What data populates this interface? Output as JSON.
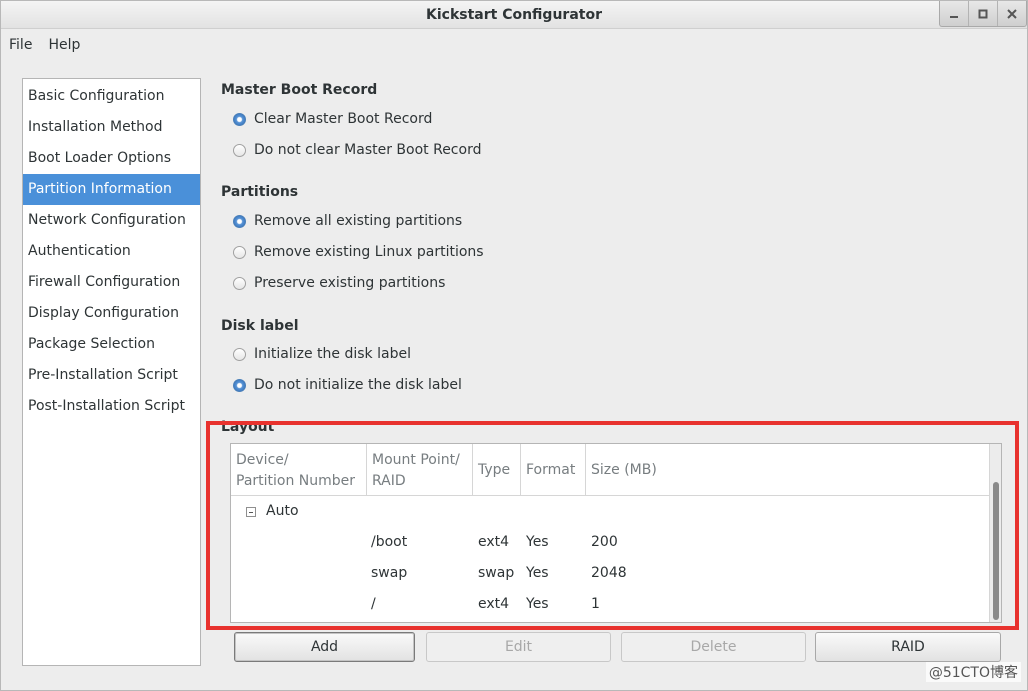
{
  "window": {
    "title": "Kickstart Configurator"
  },
  "menu": {
    "items": [
      "File",
      "Help"
    ]
  },
  "sidebar": {
    "items": [
      {
        "label": "Basic Configuration",
        "selected": false
      },
      {
        "label": "Installation Method",
        "selected": false
      },
      {
        "label": "Boot Loader Options",
        "selected": false
      },
      {
        "label": "Partition Information",
        "selected": true
      },
      {
        "label": "Network Configuration",
        "selected": false
      },
      {
        "label": "Authentication",
        "selected": false
      },
      {
        "label": "Firewall Configuration",
        "selected": false
      },
      {
        "label": "Display Configuration",
        "selected": false
      },
      {
        "label": "Package Selection",
        "selected": false
      },
      {
        "label": "Pre-Installation Script",
        "selected": false
      },
      {
        "label": "Post-Installation Script",
        "selected": false
      }
    ]
  },
  "mbr": {
    "title": "Master Boot Record",
    "options": [
      {
        "label": "Clear Master Boot Record",
        "checked": true
      },
      {
        "label": "Do not clear Master Boot Record",
        "checked": false
      }
    ]
  },
  "partitions": {
    "title": "Partitions",
    "options": [
      {
        "label": "Remove all existing partitions",
        "checked": true
      },
      {
        "label": "Remove existing Linux partitions",
        "checked": false
      },
      {
        "label": "Preserve existing partitions",
        "checked": false
      }
    ]
  },
  "disklabel": {
    "title": "Disk label",
    "options": [
      {
        "label": "Initialize the disk label",
        "checked": false
      },
      {
        "label": "Do not initialize the disk label",
        "checked": true
      }
    ]
  },
  "layout": {
    "title": "Layout",
    "columns": [
      {
        "line1": "Device/",
        "line2": "Partition Number"
      },
      {
        "line1": "Mount Point/",
        "line2": "RAID"
      },
      {
        "line1": "Type",
        "line2": ""
      },
      {
        "line1": "Format",
        "line2": ""
      },
      {
        "line1": "Size (MB)",
        "line2": ""
      }
    ],
    "group": "Auto",
    "rows": [
      {
        "mount": "/boot",
        "type": "ext4",
        "format": "Yes",
        "size": "200"
      },
      {
        "mount": "swap",
        "type": "swap",
        "format": "Yes",
        "size": "2048"
      },
      {
        "mount": "/",
        "type": "ext4",
        "format": "Yes",
        "size": "1"
      }
    ]
  },
  "buttons": {
    "add": "Add",
    "edit": "Edit",
    "delete": "Delete",
    "raid": "RAID"
  },
  "watermark": "@51CTO博客",
  "colors": {
    "selection": "#4a90d9",
    "highlight_box": "#e8322e"
  }
}
